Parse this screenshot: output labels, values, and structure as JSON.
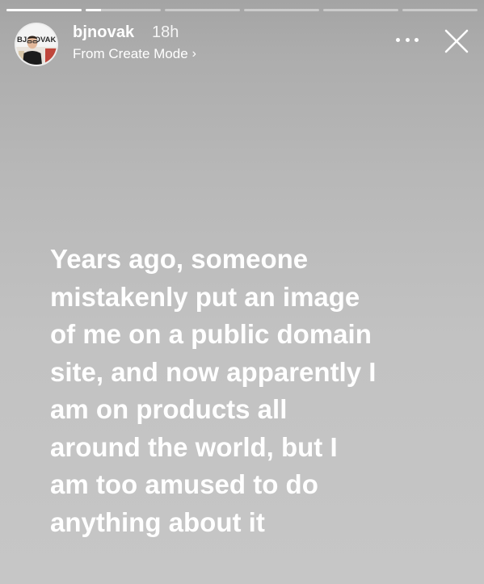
{
  "story": {
    "progress": {
      "segment_count": 6,
      "active_index": 1,
      "active_fraction": 0.2
    },
    "header": {
      "username": "bjnovak",
      "timestamp": "18h",
      "subtitle": "From Create Mode",
      "avatar_text": "BJ NOVAK"
    },
    "text_lines": [
      "Years ago, someone",
      "mistakenly put an image",
      "of me on a public domain",
      "site, and now apparently I",
      "am on products all",
      "around the world, but I",
      "am too amused to do",
      "anything about it"
    ]
  },
  "icons": {
    "more": "more-options-icon",
    "close": "close-icon",
    "chevron": "chevron-right-icon"
  }
}
